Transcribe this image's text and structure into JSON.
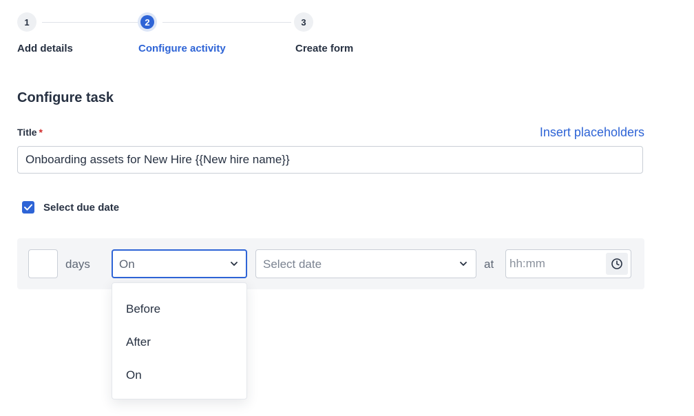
{
  "stepper": {
    "steps": [
      {
        "number": "1",
        "label": "Add details"
      },
      {
        "number": "2",
        "label": "Configure activity"
      },
      {
        "number": "3",
        "label": "Create form"
      }
    ],
    "active_step": "2"
  },
  "section": {
    "title": "Configure task"
  },
  "title_field": {
    "label": "Title",
    "required_mark": "*",
    "insert_link": "Insert placeholders",
    "value": "Onboarding assets for New Hire {{New hire name}}"
  },
  "due_date": {
    "checkbox_label": "Select due date",
    "checked": true,
    "days_value": "",
    "days_label": "days",
    "relation_select": {
      "value": "On",
      "options": [
        "Before",
        "After",
        "On"
      ]
    },
    "date_select": {
      "placeholder": "Select date"
    },
    "at_label": "at",
    "time_placeholder": "hh:mm"
  },
  "colors": {
    "accent": "#2e64d6",
    "required": "#d12c2c",
    "text": "#273142",
    "panel_bg": "#f4f5f7"
  },
  "icons": {
    "checkbox": "check-icon",
    "select_arrow": "chevron-down-icon",
    "time": "clock-icon"
  }
}
